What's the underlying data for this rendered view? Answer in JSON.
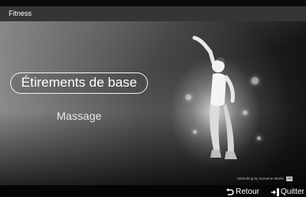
{
  "header": {
    "title": "Fitness"
  },
  "menu": {
    "items": [
      {
        "label": "Étirements de base",
        "selected": true
      },
      {
        "label": "Massage",
        "selected": false
      }
    ]
  },
  "image": {
    "credit": "Stretching by Suzanne Martin",
    "credit_badge": "XN"
  },
  "footer": {
    "actions": [
      {
        "label": "Retour",
        "icon": "return-icon"
      },
      {
        "label": "Quitter",
        "icon": "exit-icon"
      }
    ]
  }
}
